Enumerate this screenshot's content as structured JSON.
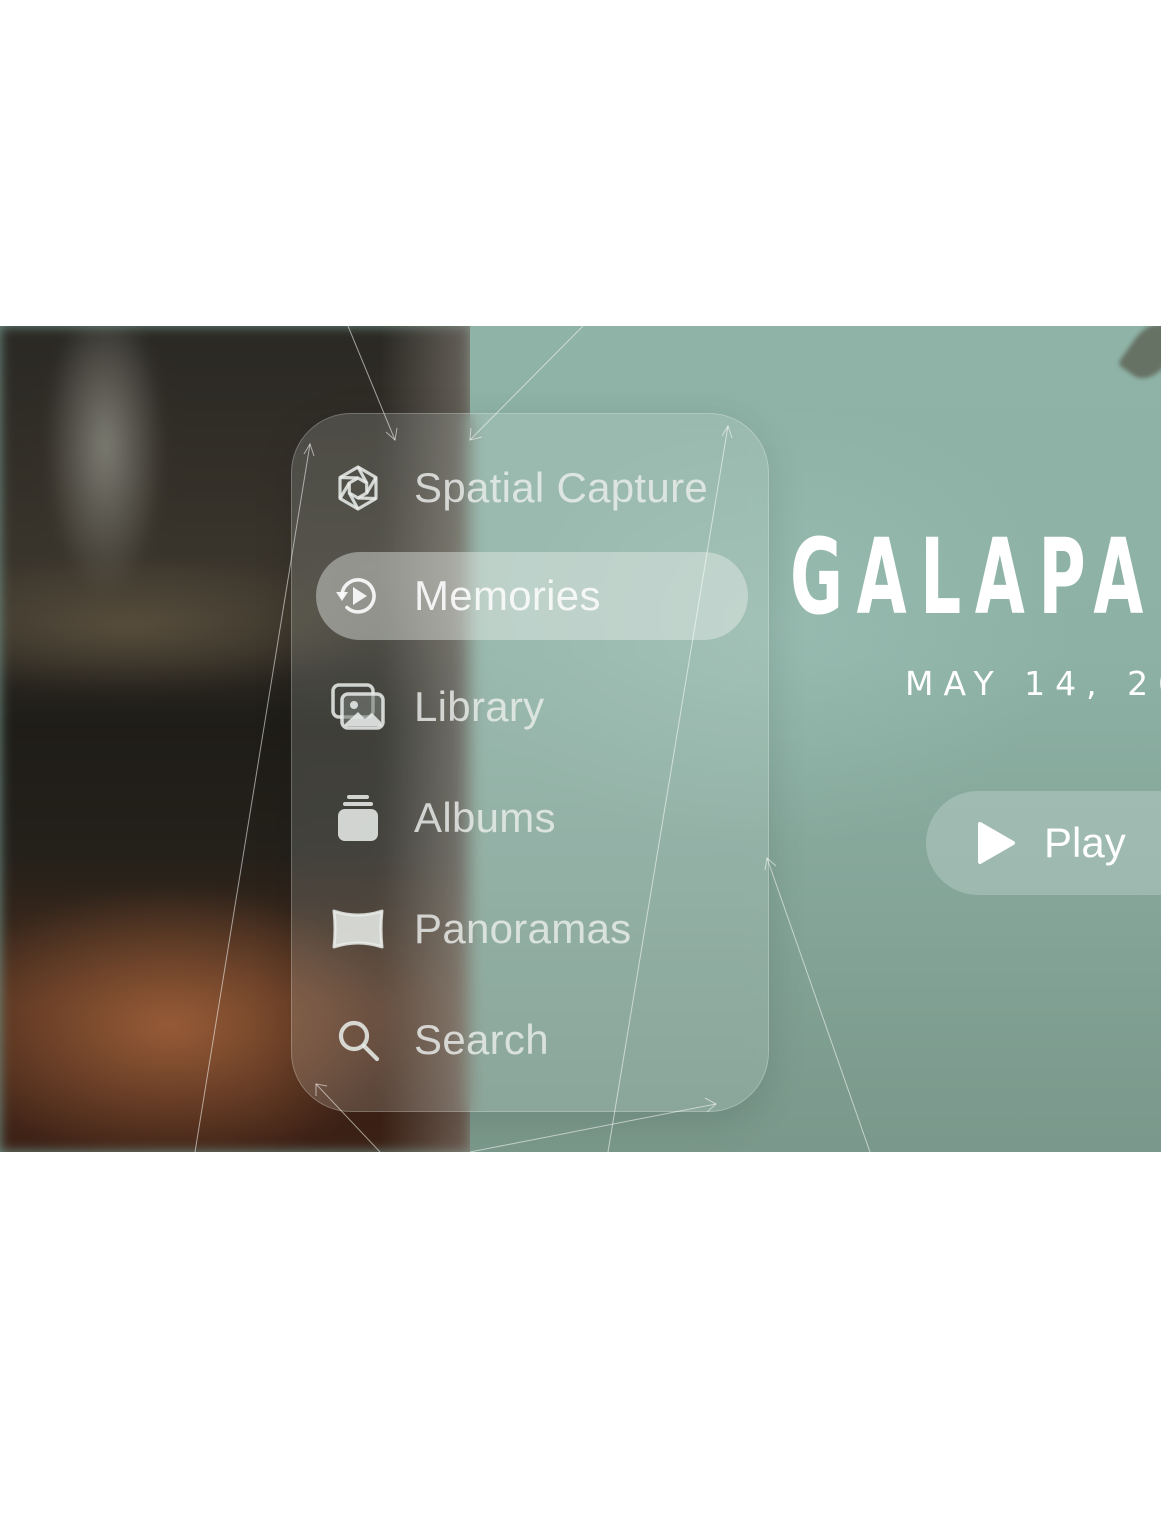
{
  "sidebar": {
    "items": [
      {
        "label": "Spatial Capture",
        "icon": "aperture-icon",
        "selected": false
      },
      {
        "label": "Memories",
        "icon": "memories-icon",
        "selected": true
      },
      {
        "label": "Library",
        "icon": "photo-library-icon",
        "selected": false
      },
      {
        "label": "Albums",
        "icon": "albums-stack-icon",
        "selected": false
      },
      {
        "label": "Panoramas",
        "icon": "panorama-icon",
        "selected": false
      },
      {
        "label": "Search",
        "icon": "search-icon",
        "selected": false
      }
    ]
  },
  "memory": {
    "title": "GALAPA",
    "date": "MAY 14, 20",
    "play_label": "Play"
  },
  "colors": {
    "teal_background": "#8fb3a7",
    "label_text": "#ebeeec",
    "title_text": "#ffffff"
  }
}
